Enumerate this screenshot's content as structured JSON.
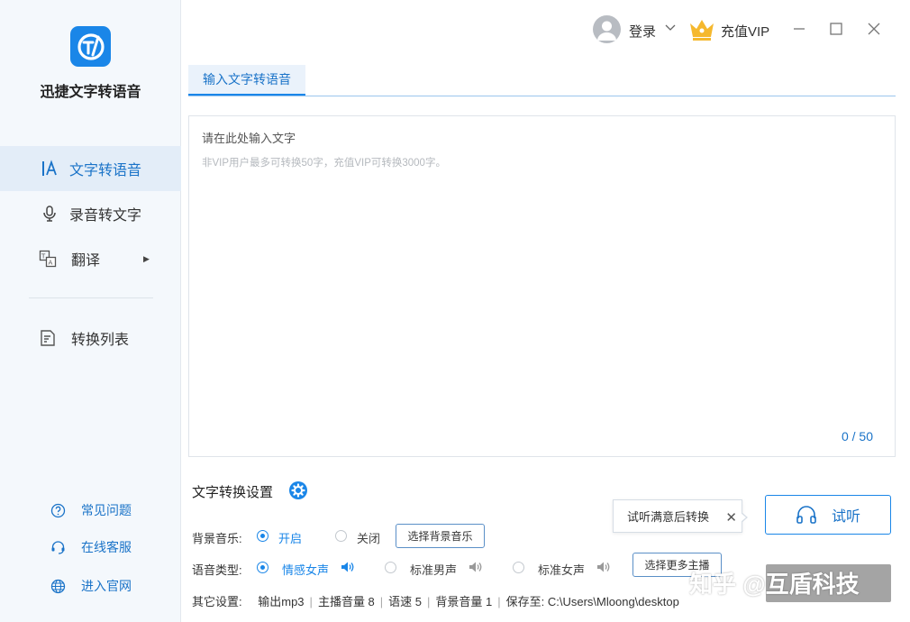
{
  "app": {
    "name": "迅捷文字转语音",
    "accent": "#1a86e8"
  },
  "sidebar": {
    "items": [
      {
        "label": "文字转语音",
        "icon": "text-a-icon",
        "active": true
      },
      {
        "label": "录音转文字",
        "icon": "microphone-icon",
        "active": false
      },
      {
        "label": "翻译",
        "icon": "translate-icon",
        "active": false
      },
      {
        "label": "转换列表",
        "icon": "document-list-icon",
        "active": false
      }
    ],
    "footer": [
      {
        "label": "常见问题",
        "icon": "question-icon"
      },
      {
        "label": "在线客服",
        "icon": "headset-service-icon"
      },
      {
        "label": "进入官网",
        "icon": "globe-icon"
      }
    ]
  },
  "header": {
    "login": "登录",
    "vip": "充值VIP"
  },
  "tabs": [
    {
      "label": "输入文字转语音"
    }
  ],
  "editor": {
    "placeholder_main": "请在此处输入文字",
    "placeholder_hint": "非VIP用户最多可转换50字，充值VIP可转换3000字。",
    "count": "0 / 50"
  },
  "settings": {
    "title": "文字转换设置",
    "bgm": {
      "label": "背景音乐:",
      "options": [
        {
          "label": "开启",
          "selected": true
        },
        {
          "label": "关闭",
          "selected": false
        }
      ],
      "button": "选择背景音乐"
    },
    "voice": {
      "label": "语音类型:",
      "options": [
        {
          "label": "情感女声",
          "selected": true
        },
        {
          "label": "标准男声",
          "selected": false
        },
        {
          "label": "标准女声",
          "selected": false
        }
      ],
      "button": "选择更多主播"
    },
    "other": {
      "label": "其它设置:",
      "items": [
        "输出mp3",
        "主播音量 8",
        "语速 5",
        "背景音量 1",
        "保存至: C:\\Users\\Mloong\\desktop"
      ]
    }
  },
  "tooltip": {
    "text": "试听满意后转换"
  },
  "listen_button": "试听",
  "watermark": "知乎 @互盾科技"
}
